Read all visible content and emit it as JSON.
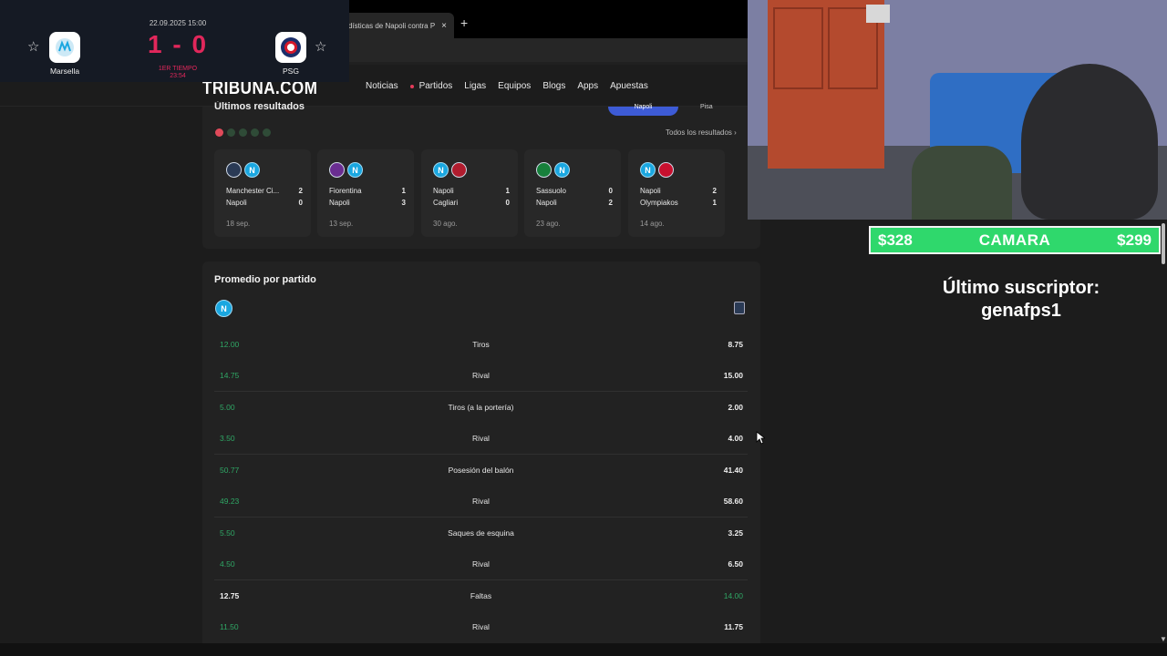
{
  "browser": {
    "tab_title": "dísticas de Napoli contra P",
    "tab_close": "×",
    "new_tab": "+"
  },
  "site": {
    "logo": "TRIBUNA.COM",
    "nav": [
      "Noticias",
      "Partidos",
      "Ligas",
      "Equipos",
      "Blogs",
      "Apps",
      "Apuestas"
    ]
  },
  "scoreboard": {
    "date": "22.09.2025 15:00",
    "score": "1 - 0",
    "period": "1ER TIEMPO",
    "minute": "23:54",
    "home": "Marsella",
    "away": "PSG",
    "star": "☆"
  },
  "results": {
    "title": "Últimos resultados",
    "toggle_left": "Napoli",
    "toggle_right": "Pisa",
    "all_link": "Todos los resultados ›",
    "cards": [
      {
        "team1": "Manchester Ci...",
        "score1": "2",
        "team2": "Napoli",
        "score2": "0",
        "date": "18 sep."
      },
      {
        "team1": "Fiorentina",
        "score1": "1",
        "team2": "Napoli",
        "score2": "3",
        "date": "13 sep."
      },
      {
        "team1": "Napoli",
        "score1": "1",
        "team2": "Cagliari",
        "score2": "0",
        "date": "30 ago."
      },
      {
        "team1": "Sassuolo",
        "score1": "0",
        "team2": "Napoli",
        "score2": "2",
        "date": "23 ago."
      },
      {
        "team1": "Napoli",
        "score1": "2",
        "team2": "Olympiakos",
        "score2": "1",
        "date": "14 ago."
      }
    ]
  },
  "averages": {
    "title": "Promedio por partido",
    "rows": [
      {
        "left": "12.00",
        "label": "Tiros",
        "right": "8.75"
      },
      {
        "left": "14.75",
        "label": "Rival",
        "right": "15.00"
      },
      {
        "left": "5.00",
        "label": "Tiros (a la portería)",
        "right": "2.00"
      },
      {
        "left": "3.50",
        "label": "Rival",
        "right": "4.00"
      },
      {
        "left": "50.77",
        "label": "Posesión del balón",
        "right": "41.40"
      },
      {
        "left": "49.23",
        "label": "Rival",
        "right": "58.60"
      },
      {
        "left": "5.50",
        "label": "Saques de esquina",
        "right": "3.25"
      },
      {
        "left": "4.50",
        "label": "Rival",
        "right": "6.50"
      },
      {
        "left": "12.75",
        "label": "Faltas",
        "right": "14.00"
      },
      {
        "left": "11.50",
        "label": "Rival",
        "right": "11.75"
      }
    ]
  },
  "stream": {
    "donation_left": "$328",
    "donation_mid": "CAMARA",
    "donation_right": "$299",
    "subscriber_label": "Último suscriptor:",
    "subscriber_name": "genafps1"
  },
  "colors": {
    "accent_red": "#e1275b",
    "green": "#2fa765",
    "donation_green": "#2fd86c",
    "napoli_blue": "#1aa7e0"
  }
}
